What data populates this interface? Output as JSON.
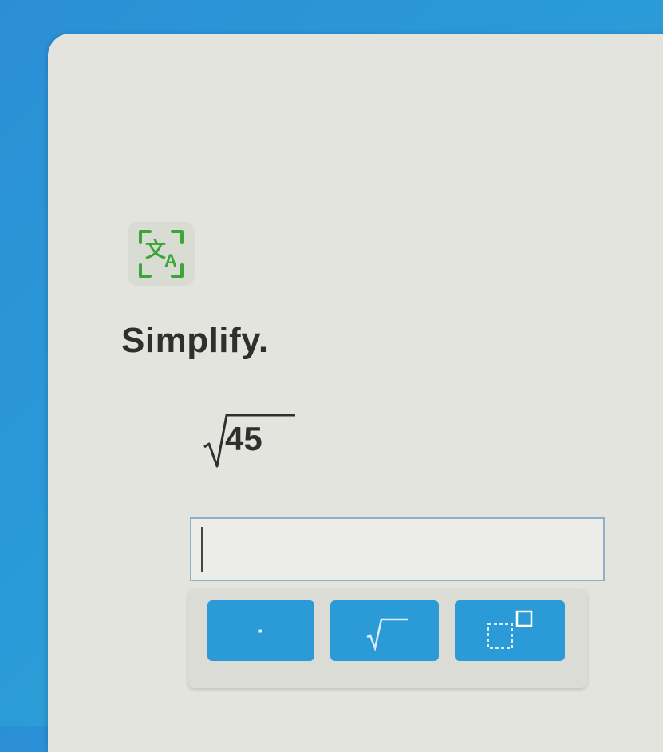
{
  "toolbar": {
    "translate_icon": "translate-icon",
    "accent_color": "#3aa637"
  },
  "problem": {
    "instruction": "Simplify.",
    "radicand": "45"
  },
  "answer_field": {
    "value": ""
  },
  "palette": {
    "color": "#2a9bd6",
    "buttons": [
      {
        "icon": "decimal-point-icon",
        "glyph": "·"
      },
      {
        "icon": "square-root-icon"
      },
      {
        "icon": "exponent-icon"
      }
    ]
  }
}
